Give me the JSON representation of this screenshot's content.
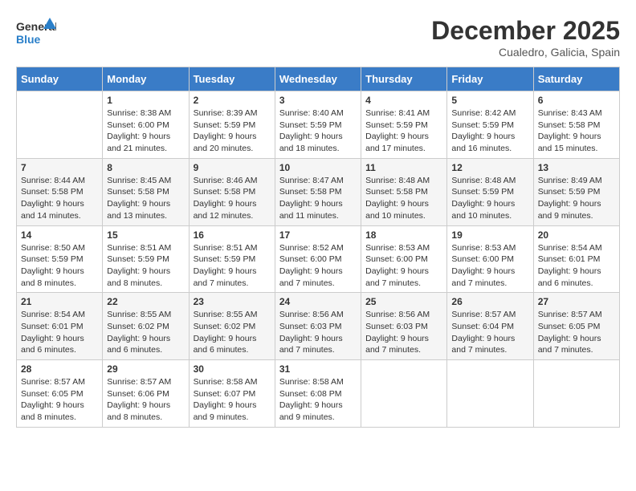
{
  "header": {
    "logo_line1": "General",
    "logo_line2": "Blue",
    "month": "December 2025",
    "location": "Cualedro, Galicia, Spain"
  },
  "days_of_week": [
    "Sunday",
    "Monday",
    "Tuesday",
    "Wednesday",
    "Thursday",
    "Friday",
    "Saturday"
  ],
  "weeks": [
    [
      {
        "day": "",
        "text": ""
      },
      {
        "day": "1",
        "text": "Sunrise: 8:38 AM\nSunset: 6:00 PM\nDaylight: 9 hours and 21 minutes."
      },
      {
        "day": "2",
        "text": "Sunrise: 8:39 AM\nSunset: 5:59 PM\nDaylight: 9 hours and 20 minutes."
      },
      {
        "day": "3",
        "text": "Sunrise: 8:40 AM\nSunset: 5:59 PM\nDaylight: 9 hours and 18 minutes."
      },
      {
        "day": "4",
        "text": "Sunrise: 8:41 AM\nSunset: 5:59 PM\nDaylight: 9 hours and 17 minutes."
      },
      {
        "day": "5",
        "text": "Sunrise: 8:42 AM\nSunset: 5:59 PM\nDaylight: 9 hours and 16 minutes."
      },
      {
        "day": "6",
        "text": "Sunrise: 8:43 AM\nSunset: 5:58 PM\nDaylight: 9 hours and 15 minutes."
      }
    ],
    [
      {
        "day": "7",
        "text": "Sunrise: 8:44 AM\nSunset: 5:58 PM\nDaylight: 9 hours and 14 minutes."
      },
      {
        "day": "8",
        "text": "Sunrise: 8:45 AM\nSunset: 5:58 PM\nDaylight: 9 hours and 13 minutes."
      },
      {
        "day": "9",
        "text": "Sunrise: 8:46 AM\nSunset: 5:58 PM\nDaylight: 9 hours and 12 minutes."
      },
      {
        "day": "10",
        "text": "Sunrise: 8:47 AM\nSunset: 5:58 PM\nDaylight: 9 hours and 11 minutes."
      },
      {
        "day": "11",
        "text": "Sunrise: 8:48 AM\nSunset: 5:58 PM\nDaylight: 9 hours and 10 minutes."
      },
      {
        "day": "12",
        "text": "Sunrise: 8:48 AM\nSunset: 5:59 PM\nDaylight: 9 hours and 10 minutes."
      },
      {
        "day": "13",
        "text": "Sunrise: 8:49 AM\nSunset: 5:59 PM\nDaylight: 9 hours and 9 minutes."
      }
    ],
    [
      {
        "day": "14",
        "text": "Sunrise: 8:50 AM\nSunset: 5:59 PM\nDaylight: 9 hours and 8 minutes."
      },
      {
        "day": "15",
        "text": "Sunrise: 8:51 AM\nSunset: 5:59 PM\nDaylight: 9 hours and 8 minutes."
      },
      {
        "day": "16",
        "text": "Sunrise: 8:51 AM\nSunset: 5:59 PM\nDaylight: 9 hours and 7 minutes."
      },
      {
        "day": "17",
        "text": "Sunrise: 8:52 AM\nSunset: 6:00 PM\nDaylight: 9 hours and 7 minutes."
      },
      {
        "day": "18",
        "text": "Sunrise: 8:53 AM\nSunset: 6:00 PM\nDaylight: 9 hours and 7 minutes."
      },
      {
        "day": "19",
        "text": "Sunrise: 8:53 AM\nSunset: 6:00 PM\nDaylight: 9 hours and 7 minutes."
      },
      {
        "day": "20",
        "text": "Sunrise: 8:54 AM\nSunset: 6:01 PM\nDaylight: 9 hours and 6 minutes."
      }
    ],
    [
      {
        "day": "21",
        "text": "Sunrise: 8:54 AM\nSunset: 6:01 PM\nDaylight: 9 hours and 6 minutes."
      },
      {
        "day": "22",
        "text": "Sunrise: 8:55 AM\nSunset: 6:02 PM\nDaylight: 9 hours and 6 minutes."
      },
      {
        "day": "23",
        "text": "Sunrise: 8:55 AM\nSunset: 6:02 PM\nDaylight: 9 hours and 6 minutes."
      },
      {
        "day": "24",
        "text": "Sunrise: 8:56 AM\nSunset: 6:03 PM\nDaylight: 9 hours and 7 minutes."
      },
      {
        "day": "25",
        "text": "Sunrise: 8:56 AM\nSunset: 6:03 PM\nDaylight: 9 hours and 7 minutes."
      },
      {
        "day": "26",
        "text": "Sunrise: 8:57 AM\nSunset: 6:04 PM\nDaylight: 9 hours and 7 minutes."
      },
      {
        "day": "27",
        "text": "Sunrise: 8:57 AM\nSunset: 6:05 PM\nDaylight: 9 hours and 7 minutes."
      }
    ],
    [
      {
        "day": "28",
        "text": "Sunrise: 8:57 AM\nSunset: 6:05 PM\nDaylight: 9 hours and 8 minutes."
      },
      {
        "day": "29",
        "text": "Sunrise: 8:57 AM\nSunset: 6:06 PM\nDaylight: 9 hours and 8 minutes."
      },
      {
        "day": "30",
        "text": "Sunrise: 8:58 AM\nSunset: 6:07 PM\nDaylight: 9 hours and 9 minutes."
      },
      {
        "day": "31",
        "text": "Sunrise: 8:58 AM\nSunset: 6:08 PM\nDaylight: 9 hours and 9 minutes."
      },
      {
        "day": "",
        "text": ""
      },
      {
        "day": "",
        "text": ""
      },
      {
        "day": "",
        "text": ""
      }
    ]
  ]
}
